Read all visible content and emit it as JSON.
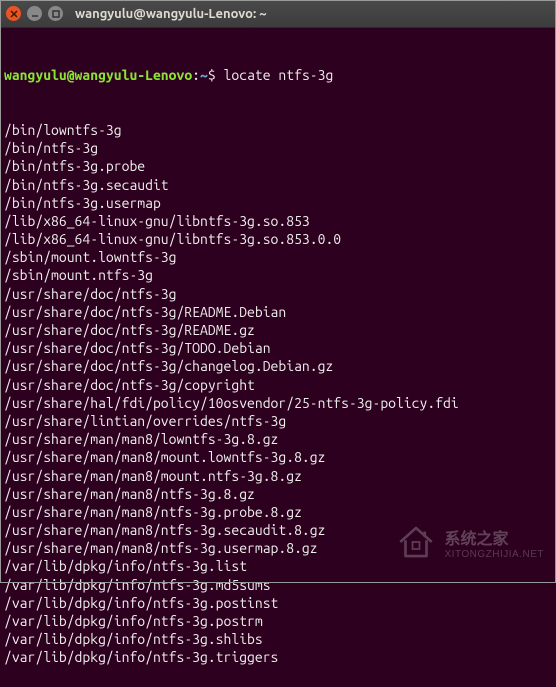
{
  "window": {
    "title": "wangyulu@wangyulu-Lenovo: ~"
  },
  "prompt": {
    "user_host": "wangyulu@wangyulu-Lenovo",
    "separator1": ":",
    "path": "~",
    "separator2": "$ ",
    "command": "locate ntfs-3g"
  },
  "output": [
    "/bin/lowntfs-3g",
    "/bin/ntfs-3g",
    "/bin/ntfs-3g.probe",
    "/bin/ntfs-3g.secaudit",
    "/bin/ntfs-3g.usermap",
    "/lib/x86_64-linux-gnu/libntfs-3g.so.853",
    "/lib/x86_64-linux-gnu/libntfs-3g.so.853.0.0",
    "/sbin/mount.lowntfs-3g",
    "/sbin/mount.ntfs-3g",
    "/usr/share/doc/ntfs-3g",
    "/usr/share/doc/ntfs-3g/README.Debian",
    "/usr/share/doc/ntfs-3g/README.gz",
    "/usr/share/doc/ntfs-3g/TODO.Debian",
    "/usr/share/doc/ntfs-3g/changelog.Debian.gz",
    "/usr/share/doc/ntfs-3g/copyright",
    "/usr/share/hal/fdi/policy/10osvendor/25-ntfs-3g-policy.fdi",
    "/usr/share/lintian/overrides/ntfs-3g",
    "/usr/share/man/man8/lowntfs-3g.8.gz",
    "/usr/share/man/man8/mount.lowntfs-3g.8.gz",
    "/usr/share/man/man8/mount.ntfs-3g.8.gz",
    "/usr/share/man/man8/ntfs-3g.8.gz",
    "/usr/share/man/man8/ntfs-3g.probe.8.gz",
    "/usr/share/man/man8/ntfs-3g.secaudit.8.gz",
    "/usr/share/man/man8/ntfs-3g.usermap.8.gz",
    "/var/lib/dpkg/info/ntfs-3g.list",
    "/var/lib/dpkg/info/ntfs-3g.md5sums",
    "/var/lib/dpkg/info/ntfs-3g.postinst",
    "/var/lib/dpkg/info/ntfs-3g.postrm",
    "/var/lib/dpkg/info/ntfs-3g.shlibs",
    "/var/lib/dpkg/info/ntfs-3g.triggers"
  ],
  "watermark": {
    "cn": "系统之家",
    "url": "XITONGZHIJIA.NET"
  }
}
